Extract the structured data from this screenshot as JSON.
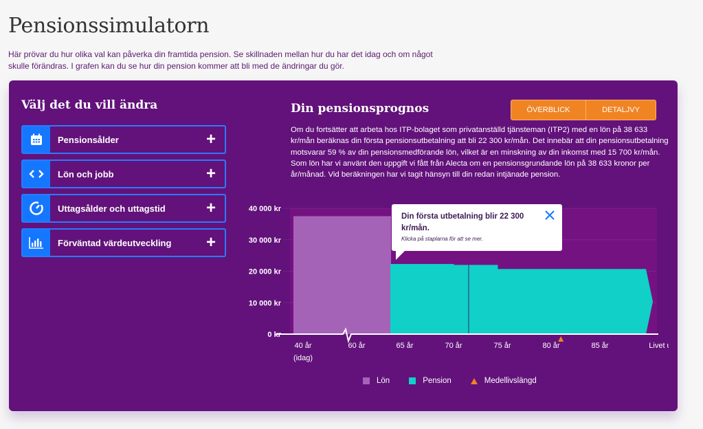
{
  "page": {
    "title": "Pensionssimulatorn",
    "intro": "Här prövar du hur olika val kan påverka din framtida pension. Se skillnaden mellan hur du har det idag och om något skulle förändras. I grafen kan du se hur din pension kommer att bli med de ändringar du gör."
  },
  "left": {
    "title": "Välj det du vill ändra",
    "options": [
      {
        "label": "Pensionsålder",
        "icon": "calendar-icon",
        "action": "+"
      },
      {
        "label": "Lön och jobb",
        "icon": "code-brackets-icon",
        "action": "+"
      },
      {
        "label": "Uttagsålder och uttagstid",
        "icon": "gauge-icon",
        "action": "+"
      },
      {
        "label": "Förväntad värdeutveckling",
        "icon": "bar-chart-icon",
        "action": "+"
      }
    ]
  },
  "right": {
    "title": "Din pensionsprognos",
    "buttons": {
      "overview": "ÖVERBLICK",
      "detail": "DETALJVY"
    },
    "description": "Om du fortsätter att arbeta hos ITP-bolaget som privatanställd tjänsteman (ITP2) med en lön på 38 633 kr/mån beräknas din första pensionsutbetalning att bli 22 300 kr/mån. Det innebär att din pensionsutbetalning motsvarar 59 % av din pensionsmedförande lön, vilket är en minskning av din inkomst med 15 700 kr/mån. Som lön har vi använt den uppgift vi fått från Alecta om en pensionsgrundande lön på 38 633 kronor per år/månad. Vid beräkningen har vi tagit hänsyn till din redan intjänade pension."
  },
  "tooltip": {
    "title": "Din första utbetalning blir 22 300 kr/mån.",
    "subtitle": "Klicka på staplarna för att se mer."
  },
  "colors": {
    "card": "#62127a",
    "plot_bg": "#741282",
    "lon": "#a563b8",
    "pension": "#10d0c8",
    "accent": "#f08423",
    "option_blue": "#1577ff"
  },
  "chart_data": {
    "type": "area",
    "ylabel": "",
    "xlabel": "",
    "ylim": [
      0,
      40000
    ],
    "yticks": [
      "0 kr",
      "10 000 kr",
      "20 000 kr",
      "30 000 kr",
      "40 000 kr"
    ],
    "ytick_values": [
      0,
      10000,
      20000,
      30000,
      40000
    ],
    "xticks": [
      "40 år",
      "60 år",
      "65 år",
      "70 år",
      "75 år",
      "80 år",
      "85 år",
      "Livet ut"
    ],
    "xtick_sub": {
      "40 år": "(idag)"
    },
    "axis_break_between": [
      "40 år",
      "60 år"
    ],
    "grid": true,
    "series": [
      {
        "name": "Lön",
        "segments": [
          {
            "from": "40 år",
            "to": "65 år",
            "value": 37500
          }
        ]
      },
      {
        "name": "Pension",
        "segments": [
          {
            "from": 65,
            "to": 70,
            "value": 22300
          },
          {
            "from": 70,
            "to": 72.5,
            "value": 22000
          },
          {
            "from": 72.5,
            "to": 74.5,
            "value": 22000
          },
          {
            "from": 74.5,
            "to": "Livet ut",
            "value": 20700
          }
        ]
      }
    ],
    "markers": [
      {
        "name": "Medellivslängd",
        "x": 81
      }
    ],
    "legend": [
      "Lön",
      "Pension",
      "Medellivslängd"
    ],
    "legend_position": "bottom"
  }
}
